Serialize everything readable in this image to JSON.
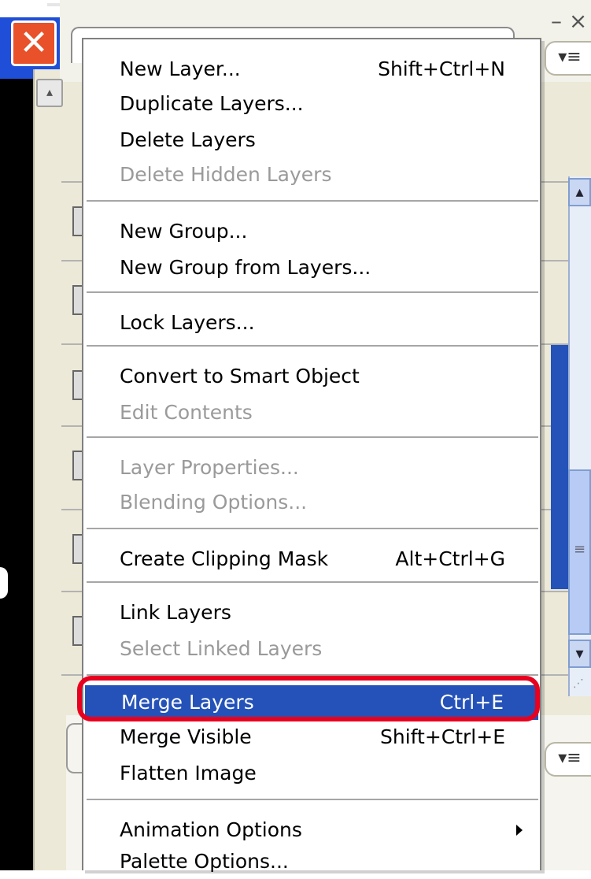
{
  "window": {
    "close_glyph": "✕",
    "min_glyph": "– ×",
    "panel_menu_glyph": "▾≡",
    "scroll_up_glyph": "▴",
    "scroll_down_glyph": "▾",
    "thumb_grip_glyph": "≡",
    "resize_grip_glyph": "⋰",
    "colors": {
      "title_blue": "#1f4fd8",
      "close_red": "#e8512a",
      "highlight": "#2452b8",
      "callout_red": "#e8001f"
    }
  },
  "menu": {
    "items": [
      {
        "label": "New Layer...",
        "shortcut": "Shift+Ctrl+N",
        "enabled": true
      },
      {
        "label": "Duplicate Layers...",
        "shortcut": "",
        "enabled": true
      },
      {
        "label": "Delete Layers",
        "shortcut": "",
        "enabled": true
      },
      {
        "label": "Delete Hidden Layers",
        "shortcut": "",
        "enabled": false
      },
      {
        "label": "New Group...",
        "shortcut": "",
        "enabled": true
      },
      {
        "label": "New Group from Layers...",
        "shortcut": "",
        "enabled": true
      },
      {
        "label": "Lock Layers...",
        "shortcut": "",
        "enabled": true
      },
      {
        "label": "Convert to Smart Object",
        "shortcut": "",
        "enabled": true
      },
      {
        "label": "Edit Contents",
        "shortcut": "",
        "enabled": false
      },
      {
        "label": "Layer Properties...",
        "shortcut": "",
        "enabled": false
      },
      {
        "label": "Blending Options...",
        "shortcut": "",
        "enabled": false
      },
      {
        "label": "Create Clipping Mask",
        "shortcut": "Alt+Ctrl+G",
        "enabled": true
      },
      {
        "label": "Link Layers",
        "shortcut": "",
        "enabled": true
      },
      {
        "label": "Select Linked Layers",
        "shortcut": "",
        "enabled": false
      },
      {
        "label": "Merge Layers",
        "shortcut": "Ctrl+E",
        "enabled": true,
        "highlighted": true
      },
      {
        "label": "Merge Visible",
        "shortcut": "Shift+Ctrl+E",
        "enabled": true
      },
      {
        "label": "Flatten Image",
        "shortcut": "",
        "enabled": true
      },
      {
        "label": "Animation Options",
        "shortcut": "",
        "enabled": true,
        "submenu": true
      },
      {
        "label": "Palette Options...",
        "shortcut": "",
        "enabled": true
      }
    ]
  }
}
